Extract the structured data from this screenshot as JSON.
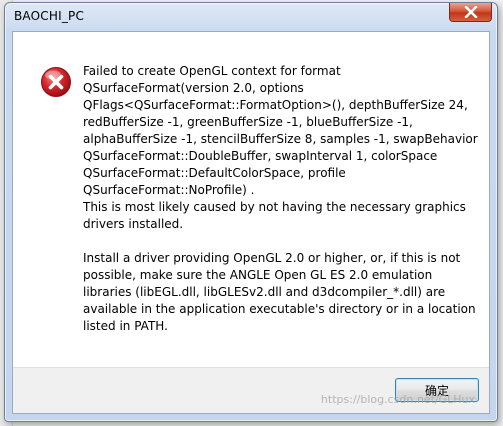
{
  "window": {
    "title": "BAOCHI_PC",
    "close_glyph": "✕"
  },
  "dialog": {
    "icon": "error-icon",
    "paragraph1": [
      "Failed to create OpenGL context for format",
      "QSurfaceFormat(version 2.0, options",
      "QFlags<QSurfaceFormat::FormatOption>(), depthBufferSize 24,",
      "redBufferSize -1, greenBufferSize -1, blueBufferSize -1,",
      "alphaBufferSize -1, stencilBufferSize 8, samples -1, swapBehavior",
      "QSurfaceFormat::DoubleBuffer, swapInterval 1, colorSpace",
      "QSurfaceFormat::DefaultColorSpace, profile",
      "QSurfaceFormat::NoProfile) .",
      "This is most likely caused by not having the necessary graphics",
      "drivers installed."
    ],
    "paragraph2": [
      "Install a driver providing OpenGL 2.0 or higher, or, if this is not",
      "possible, make sure the ANGLE Open GL ES 2.0 emulation",
      "libraries (libEGL.dll, libGLESv2.dll and d3dcompiler_*.dll) are",
      "available in the application executable's directory or in a location",
      "listed in PATH."
    ]
  },
  "footer": {
    "ok_label": "确定"
  },
  "watermark": "https://blog.csdn.net/GLHux",
  "colors": {
    "error_red": "#d2232a",
    "close_red": "#c1361b",
    "button_border": "#3c7fb1",
    "frame": "#c5d6ec"
  }
}
